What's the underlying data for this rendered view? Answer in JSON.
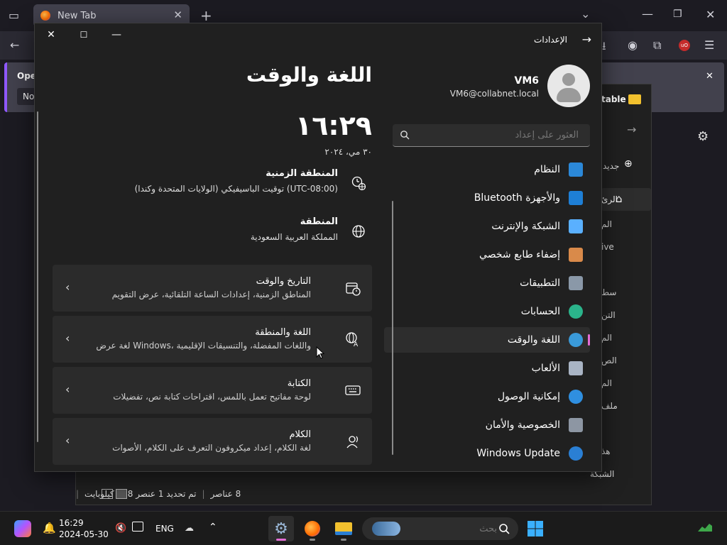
{
  "firefox": {
    "tab_title": "New Tab",
    "notice_title": "Oper",
    "notice_button": "No"
  },
  "explorer": {
    "sidebar": [
      "جديد",
      "الرئ",
      "الم",
      "ive",
      "سط",
      "التن",
      "الم",
      "الص",
      "الم",
      "ملف",
      "هذ",
      "الشبكة"
    ],
    "breadcrumb": "table",
    "status": {
      "items": "8 عناصر",
      "selected": "تم تحديد 1 عنصر  568 كيلوبايت"
    }
  },
  "settings": {
    "header_title": "الإعدادات",
    "user": {
      "name": "VM6",
      "email": "VM6@collabnet.local"
    },
    "search_placeholder": "العثور على إعداد",
    "nav": [
      {
        "label": "النظام",
        "icon": "system-icon",
        "color": "#2b88d8"
      },
      {
        "label": "Bluetooth والأجهزة",
        "icon": "bluetooth-icon",
        "color": "#1e7fd6"
      },
      {
        "label": "الشبكة والإنترنت",
        "icon": "network-icon",
        "color": "#5ab0ff"
      },
      {
        "label": "إضفاء طابع شخصي",
        "icon": "personalization-icon",
        "color": "#d98a4a"
      },
      {
        "label": "التطبيقات",
        "icon": "apps-icon",
        "color": "#8a98a8"
      },
      {
        "label": "الحسابات",
        "icon": "accounts-icon",
        "color": "#2bb48b"
      },
      {
        "label": "اللغة والوقت",
        "icon": "time-language-icon",
        "color": "#3a9ad9"
      },
      {
        "label": "الألعاب",
        "icon": "gaming-icon",
        "color": "#a9b4c4"
      },
      {
        "label": "إمكانية الوصول",
        "icon": "accessibility-icon",
        "color": "#2f8fe0"
      },
      {
        "label": "الخصوصية والأمان",
        "icon": "privacy-icon",
        "color": "#8d96a3"
      },
      {
        "label": "Windows Update",
        "icon": "windows-update-icon",
        "color": "#2a7fd4"
      }
    ],
    "page_title": "اللغة والوقت",
    "clock": "١٦:٢٩",
    "date": "٣٠ مي، ٢٠٢٤",
    "timezone": {
      "title": "المنطقة الزمنية",
      "value": "توقيت الباسيفيكي (الولايات المتحدة وكندا) (UTC-08:00)"
    },
    "region": {
      "title": "المنطقة",
      "value": "المملكة العربية السعودية"
    },
    "cards": [
      {
        "title": "التاريخ والوقت",
        "subtitle": "المناطق الزمنية، إعدادات الساعة التلقائية، عرض التقويم",
        "icon": "calendar-clock-icon"
      },
      {
        "title": "اللغة والمنطقة",
        "subtitle": "لغة عرض Windows، واللغات المفضلة، والتنسيقات الإقليمية",
        "icon": "language-icon"
      },
      {
        "title": "الكتابة",
        "subtitle": "لوحة مفاتيح تعمل باللمس، اقتراحات كتابة نص، تفضيلات",
        "icon": "keyboard-icon"
      },
      {
        "title": "الكلام",
        "subtitle": "لغة الكلام، إعداد ميكروفون التعرف على الكلام، الأصوات",
        "icon": "speech-icon"
      }
    ]
  },
  "taskbar": {
    "time": "16:29",
    "date": "2024-05-30",
    "lang": "ENG",
    "search_placeholder": "بحث"
  }
}
